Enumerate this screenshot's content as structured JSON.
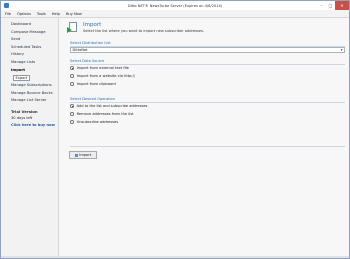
{
  "window": {
    "title": "Ditto NET® NewsTurbo Server (Expires on 4/6/2014)"
  },
  "menu": [
    "File",
    "Options",
    "Tools",
    "Help",
    "Buy Now"
  ],
  "sidebar": {
    "items": [
      {
        "label": "Dashboard"
      },
      {
        "label": "Compose Message"
      },
      {
        "label": "Send"
      },
      {
        "label": "Scheduled Tasks"
      },
      {
        "label": "History"
      },
      {
        "label": "Manage Lists"
      },
      {
        "label": "Import",
        "active": true
      },
      {
        "label": "Export",
        "sub": true
      },
      {
        "label": "Manage Subscriptions"
      },
      {
        "label": "Manage Bounce Backs"
      },
      {
        "label": "Manage List Server"
      }
    ],
    "trial": {
      "heading": "Trial Version",
      "days": "30 days left",
      "link": "Click here to buy now"
    }
  },
  "main": {
    "header": {
      "title": "Import",
      "description": "Select the list where you want to import new subscriber addresses."
    },
    "distribution": {
      "label": "Select Distribution List",
      "value": "DittoNet",
      "chevron": "▾"
    },
    "source": {
      "label": "Select Data Source",
      "options": [
        {
          "label": "Import from external text file",
          "checked": true
        },
        {
          "label": "Import from a website via http://",
          "checked": false
        },
        {
          "label": "Import from clipboard",
          "checked": false
        }
      ]
    },
    "operation": {
      "label": "Select Desired Operation",
      "options": [
        {
          "label": "Add to the list and subscribe addresses",
          "checked": true
        },
        {
          "label": "Remove addresses from the list",
          "checked": false
        },
        {
          "label": "Unsubscribe addresses",
          "checked": false
        }
      ]
    },
    "import_button": "Import"
  },
  "colors": {
    "accent": "#2a6db0",
    "link": "#1a5aa8",
    "close": "#c7504a"
  }
}
